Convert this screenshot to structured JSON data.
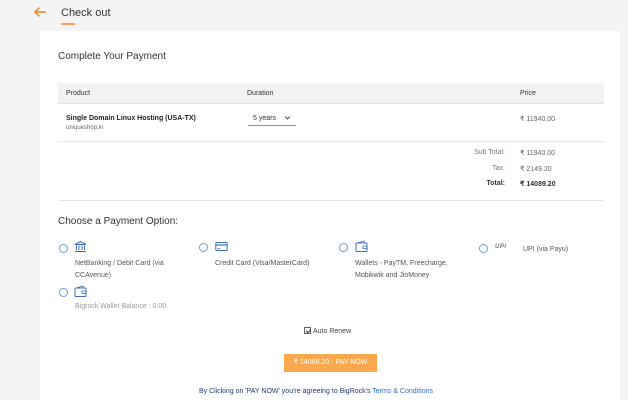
{
  "header": {
    "title": "Check out"
  },
  "payment": {
    "title": "Complete Your Payment",
    "table": {
      "headers": {
        "product": "Product",
        "duration": "Duration",
        "price": "Price"
      },
      "row": {
        "product": "Single Domain Linux Hosting (USA-TX)",
        "domain": "uniqueshop.in",
        "duration": "5 years",
        "price": "₹ 11940.00"
      }
    },
    "summary": {
      "subtotal_label": "Sub Total:",
      "subtotal": "₹ 11940.00",
      "tax_label": "Tax:",
      "tax": "₹ 2149.20",
      "total_label": "Total:",
      "total": "₹ 14089.20"
    }
  },
  "options": {
    "title": "Choose a Payment Option:",
    "netbanking_line1": "NetBanking / Debit Card (via",
    "netbanking_line2": "CCAvenue)",
    "credit": "Credit Card (Visa/MasterCard)",
    "wallets_line1": "Wallets - PayTM, Freecharge,",
    "wallets_line2": "Mobikwik and JioMoney",
    "upi_logo": "UPI",
    "upi": "UPI (via Payu)",
    "bigrock": "Bigrock Wallet Balance : 0.00"
  },
  "auto_renew": {
    "label": "Auto Renew",
    "checked": true
  },
  "pay_button": "₹ 14089.20 - PAY NOW",
  "terms": {
    "prefix": "By Clicking on 'PAY NOW' you're agreeing to BigRock's ",
    "link": "Terms & Conditions"
  },
  "colors": {
    "accent": "#f07c24",
    "button": "#f9a84e",
    "radio": "#6a9fd8",
    "link": "#2a6cc7"
  },
  "icons": [
    "back-arrow-icon",
    "chevron-down-icon",
    "bank-icon",
    "credit-card-icon",
    "wallet-icon",
    "upi-logo-icon",
    "checkbox-checked-icon"
  ]
}
